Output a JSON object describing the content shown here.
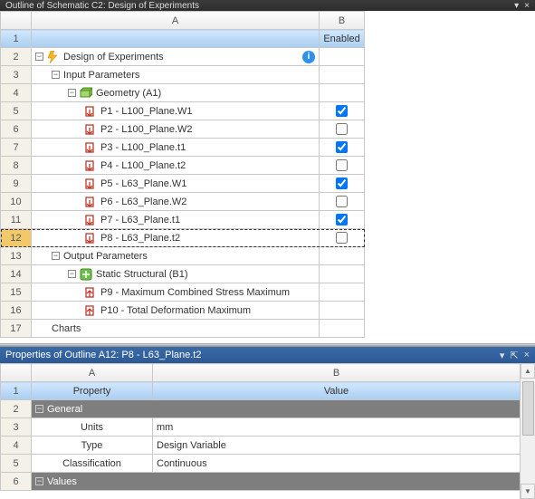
{
  "outline": {
    "title": "Outline of Schematic C2: Design of Experiments",
    "col_letters": [
      "A",
      "B"
    ],
    "header_b": "Enabled",
    "rows": [
      {
        "n": "1",
        "type": "header"
      },
      {
        "n": "2",
        "indent": 0,
        "exp": "-",
        "icon": "lightning",
        "text": "Design of Experiments",
        "info": true
      },
      {
        "n": "3",
        "indent": 1,
        "exp": "-",
        "icon": "",
        "text": "Input Parameters"
      },
      {
        "n": "4",
        "indent": 2,
        "exp": "-",
        "icon": "geom",
        "text": "Geometry (A1)"
      },
      {
        "n": "5",
        "indent": 3,
        "icon": "param-in",
        "text": "P1 - L100_Plane.W1",
        "chk": true
      },
      {
        "n": "6",
        "indent": 3,
        "icon": "param-in",
        "text": "P2 - L100_Plane.W2",
        "chk": false
      },
      {
        "n": "7",
        "indent": 3,
        "icon": "param-in",
        "text": "P3 - L100_Plane.t1",
        "chk": true
      },
      {
        "n": "8",
        "indent": 3,
        "icon": "param-in",
        "text": "P4 - L100_Plane.t2",
        "chk": false
      },
      {
        "n": "9",
        "indent": 3,
        "icon": "param-in",
        "text": "P5 - L63_Plane.W1",
        "chk": true
      },
      {
        "n": "10",
        "indent": 3,
        "icon": "param-in",
        "text": "P6 - L63_Plane.W2",
        "chk": false
      },
      {
        "n": "11",
        "indent": 3,
        "icon": "param-in",
        "text": "P7 - L63_Plane.t1",
        "chk": true
      },
      {
        "n": "12",
        "indent": 3,
        "icon": "param-in",
        "text": "P8 - L63_Plane.t2",
        "chk": false,
        "selected": true
      },
      {
        "n": "13",
        "indent": 1,
        "exp": "-",
        "icon": "",
        "text": "Output Parameters"
      },
      {
        "n": "14",
        "indent": 2,
        "exp": "-",
        "icon": "struct",
        "text": "Static Structural (B1)"
      },
      {
        "n": "15",
        "indent": 3,
        "icon": "param-out",
        "text": "P9 - Maximum Combined Stress Maximum"
      },
      {
        "n": "16",
        "indent": 3,
        "icon": "param-out",
        "text": "P10 - Total Deformation Maximum"
      },
      {
        "n": "17",
        "indent": 1,
        "icon": "",
        "text": "Charts"
      }
    ]
  },
  "properties": {
    "title": "Properties of Outline A12: P8 - L63_Plane.t2",
    "col_letters": [
      "A",
      "B"
    ],
    "header_a": "Property",
    "header_b": "Value",
    "section": "General",
    "rows": [
      {
        "n": "3",
        "prop": "Units",
        "val": "mm"
      },
      {
        "n": "4",
        "prop": "Type",
        "val": "Design Variable"
      },
      {
        "n": "5",
        "prop": "Classification",
        "val": "Continuous"
      }
    ],
    "section2": "Values",
    "section2_n": "6"
  }
}
